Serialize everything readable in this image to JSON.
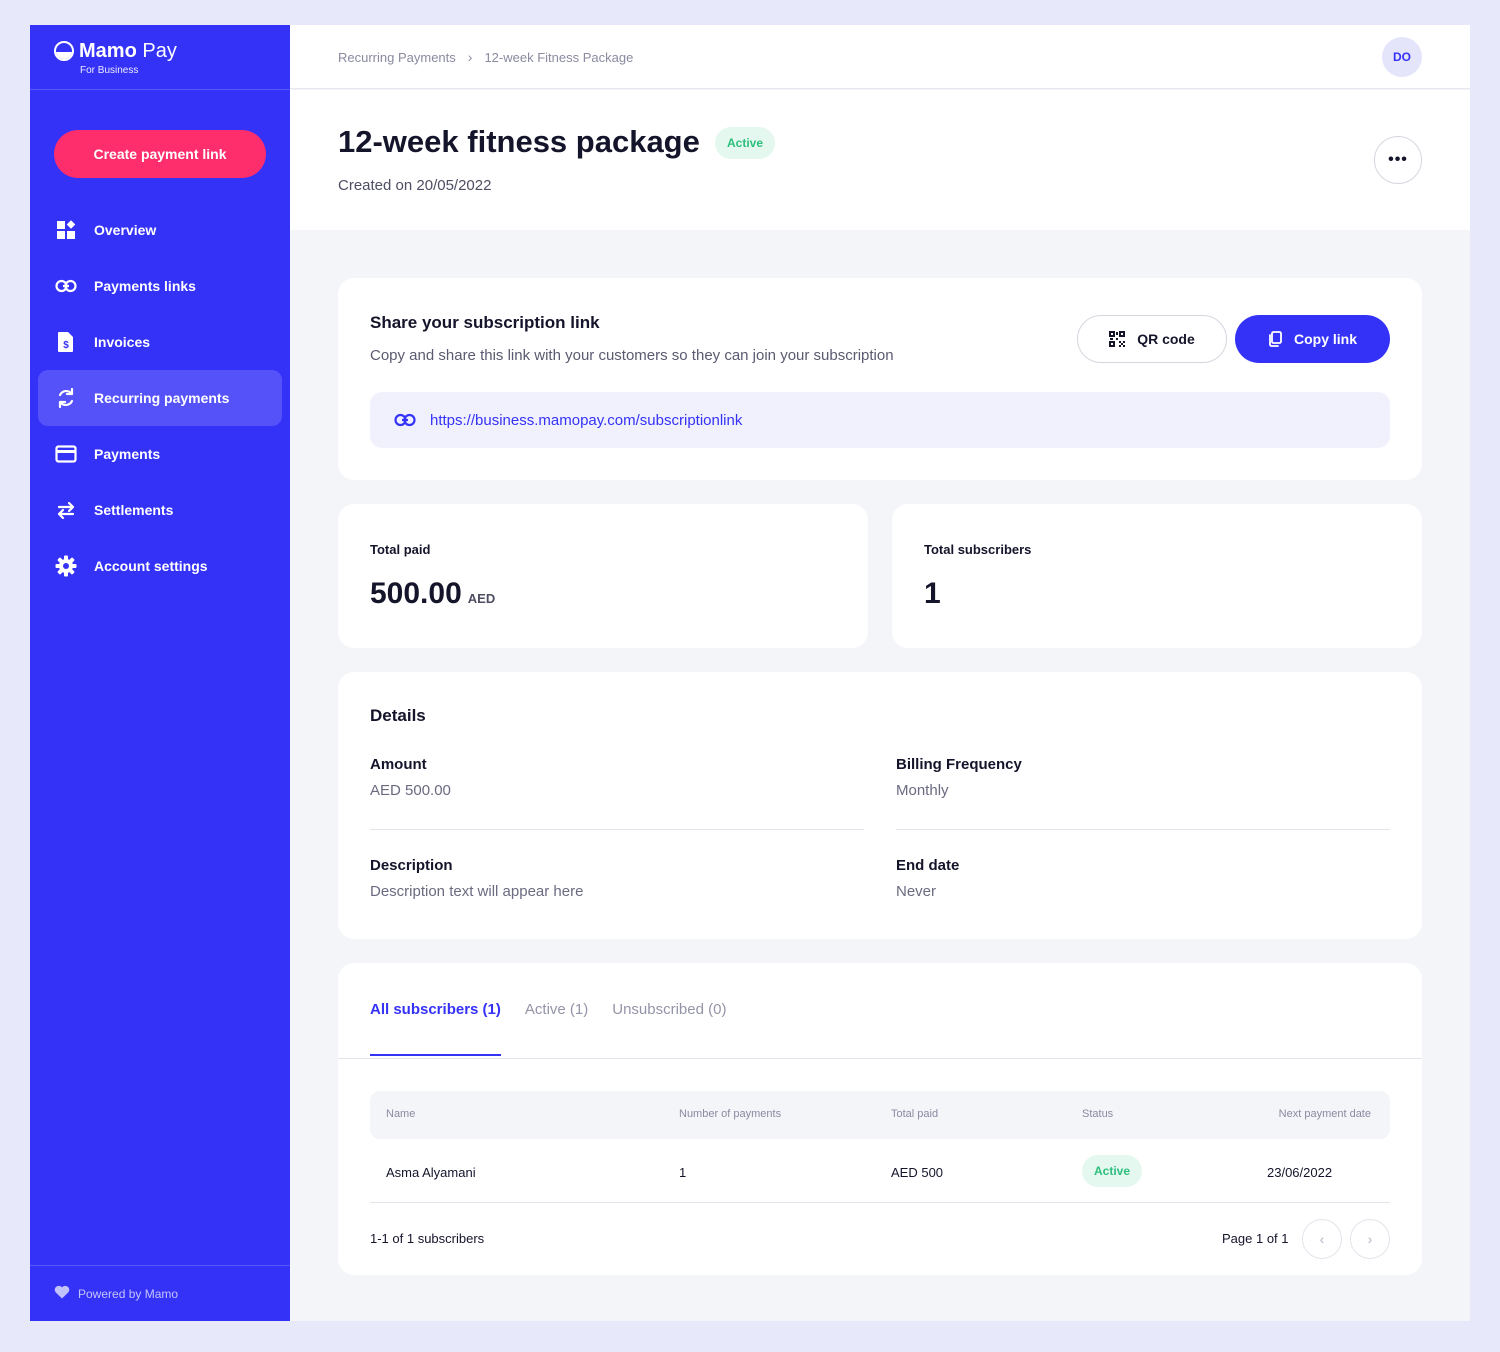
{
  "brand": {
    "name_bold": "Mamo",
    "name_light": " Pay",
    "subtitle": "For Business",
    "primary_color": "#3532f8",
    "accent_color": "#fe2e6c"
  },
  "sidebar": {
    "create_button": "Create payment link",
    "items": [
      {
        "label": "Overview",
        "icon": "overview-grid-icon",
        "active": false
      },
      {
        "label": "Payments links",
        "icon": "link-icon",
        "active": false
      },
      {
        "label": "Invoices",
        "icon": "invoice-icon",
        "active": false
      },
      {
        "label": "Recurring payments",
        "icon": "recurring-icon",
        "active": true
      },
      {
        "label": "Payments",
        "icon": "card-icon",
        "active": false
      },
      {
        "label": "Settlements",
        "icon": "transfer-arrows-icon",
        "active": false
      },
      {
        "label": "Account settings",
        "icon": "gear-icon",
        "active": false
      }
    ],
    "footer": "Powered by Mamo"
  },
  "topbar": {
    "breadcrumb": [
      "Recurring Payments",
      "12-week Fitness Package"
    ],
    "avatar_initials": "DO"
  },
  "header": {
    "title": "12-week fitness package",
    "status": "Active",
    "created": "Created on 20/05/2022",
    "more_label": "•••"
  },
  "share": {
    "title": "Share your subscription link",
    "description": "Copy and share this link with your customers so they can join your subscription",
    "qr_button": "QR code",
    "copy_button": "Copy link",
    "link": "https://business.mamopay.com/subscriptionlink"
  },
  "stats": {
    "total_paid_label": "Total paid",
    "total_paid_value": "500.00",
    "total_paid_unit": "AED",
    "total_subscribers_label": "Total subscribers",
    "total_subscribers_value": "1"
  },
  "details": {
    "title": "Details",
    "amount_label": "Amount",
    "amount_value": "AED 500.00",
    "frequency_label": "Billing Frequency",
    "frequency_value": "Monthly",
    "description_label": "Description",
    "description_value": "Description text will appear here",
    "end_date_label": "End date",
    "end_date_value": "Never"
  },
  "subscribers": {
    "tabs": [
      {
        "label": "All subscribers (1)",
        "active": true
      },
      {
        "label": "Active (1)",
        "active": false
      },
      {
        "label": "Unsubscribed (0)",
        "active": false
      }
    ],
    "columns": [
      "Name",
      "Number of payments",
      "Total paid",
      "Status",
      "Next payment date"
    ],
    "rows": [
      {
        "name": "Asma Alyamani",
        "payments": "1",
        "total_paid": "AED 500",
        "status": "Active",
        "next_date": "23/06/2022"
      }
    ],
    "count_text": "1-1 of 1 subscribers",
    "page_text": "Page 1 of 1",
    "prev_label": "‹",
    "next_label": "›"
  }
}
